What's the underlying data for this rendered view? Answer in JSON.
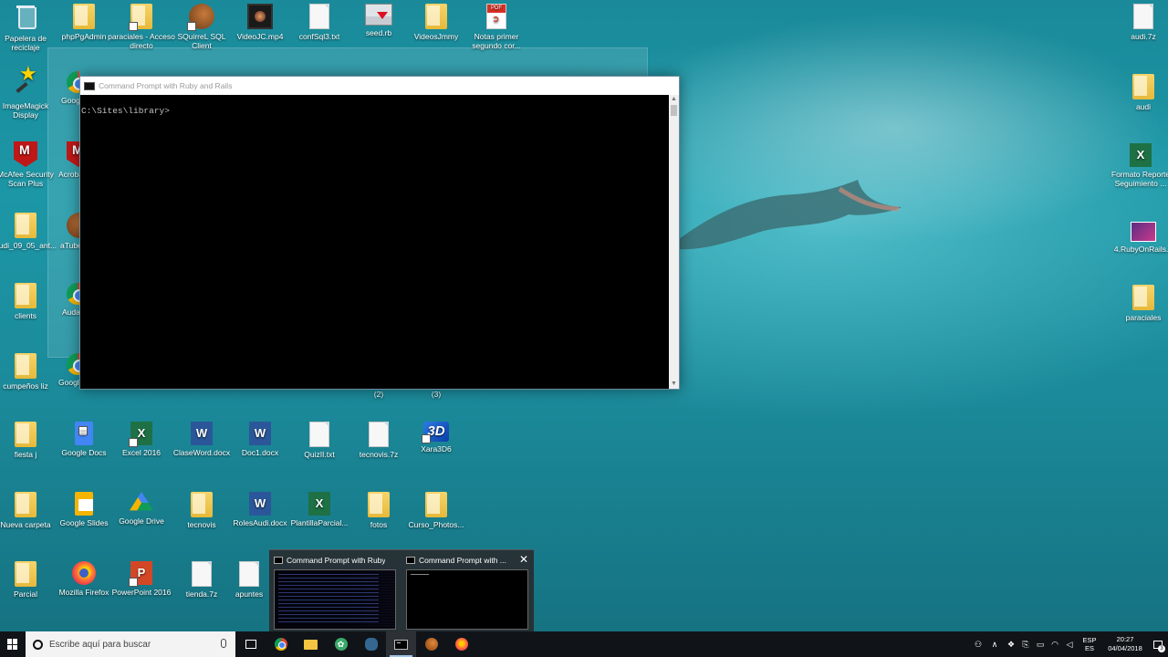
{
  "desktop": {
    "icons": [
      {
        "label": "Papelera de reciclaje",
        "icon": "recycle-bin-icon"
      },
      {
        "label": "phpPgAdmin",
        "icon": "folder-icon"
      },
      {
        "label": "paraciales - Acceso directo",
        "icon": "folder-shortcut-icon"
      },
      {
        "label": "SQuirreL SQL Client",
        "icon": "squirrel-icon"
      },
      {
        "label": "VideoJC.mp4",
        "icon": "video-icon"
      },
      {
        "label": "confSql3.txt",
        "icon": "text-file-icon"
      },
      {
        "label": "seed.rb",
        "icon": "ruby-file-icon"
      },
      {
        "label": "VideosJmmy",
        "icon": "folder-icon"
      },
      {
        "label": "Notas primer segundo cor...",
        "icon": "pdf-icon"
      },
      {
        "label": "audi.7z",
        "icon": "archive-file-icon"
      },
      {
        "label": "ImageMagick Display",
        "icon": "imagemagick-icon"
      },
      {
        "label": "Goog",
        "icon": "google-icon"
      },
      {
        "label": "audi",
        "icon": "folder-icon"
      },
      {
        "label": "McAfee Security Scan Plus",
        "icon": "mcafee-icon"
      },
      {
        "label": "Acroba",
        "icon": "acrobat-icon"
      },
      {
        "label": "Formato Reporte Seguimiento ...",
        "icon": "excel-icon"
      },
      {
        "label": "audi_09_05_ant...",
        "icon": "folder-icon"
      },
      {
        "label": "aTube",
        "icon": "atube-icon"
      },
      {
        "label": "4.RubyOnRails...",
        "icon": "certificate-icon"
      },
      {
        "label": "clients",
        "icon": "folder-icon"
      },
      {
        "label": "Auda",
        "icon": "audacity-icon"
      },
      {
        "label": "paraciales",
        "icon": "folder-icon"
      },
      {
        "label": "cumpeños liz",
        "icon": "folder-icon"
      },
      {
        "label": "Googl",
        "icon": "chrome-icon"
      },
      {
        "label": "(2)",
        "icon": "none"
      },
      {
        "label": "(3)",
        "icon": "none"
      },
      {
        "label": "fiesta j",
        "icon": "folder-icon"
      },
      {
        "label": "Google Docs",
        "icon": "google-docs-icon"
      },
      {
        "label": "Excel 2016",
        "icon": "excel-icon"
      },
      {
        "label": "ClaseWord.docx",
        "icon": "word-icon"
      },
      {
        "label": "Doc1.docx",
        "icon": "word-icon"
      },
      {
        "label": "QuizII.txt",
        "icon": "text-file-icon"
      },
      {
        "label": "tecnovis.7z",
        "icon": "archive-file-icon"
      },
      {
        "label": "Xara3D6",
        "icon": "xara3d-icon"
      },
      {
        "label": "Nueva carpeta",
        "icon": "folder-icon"
      },
      {
        "label": "Google Slides",
        "icon": "google-slides-icon"
      },
      {
        "label": "Google Drive",
        "icon": "google-drive-icon"
      },
      {
        "label": "tecnovis",
        "icon": "folder-icon"
      },
      {
        "label": "RolesAudi.docx",
        "icon": "word-icon"
      },
      {
        "label": "PlantillaParcial...",
        "icon": "excel-icon"
      },
      {
        "label": "fotos",
        "icon": "folder-icon"
      },
      {
        "label": "Curso_Photos...",
        "icon": "folder-icon"
      },
      {
        "label": "Parcial",
        "icon": "folder-icon"
      },
      {
        "label": "Mozilla Firefox",
        "icon": "firefox-icon"
      },
      {
        "label": "PowerPoint 2016",
        "icon": "powerpoint-icon"
      },
      {
        "label": "tienda.7z",
        "icon": "archive-file-icon"
      },
      {
        "label": "apuntes",
        "icon": "text-file-icon"
      }
    ]
  },
  "cmd_window": {
    "title": "Command Prompt with Ruby and Rails",
    "prompt": "C:\\Sites\\library>"
  },
  "taskbar_previews": {
    "items": [
      {
        "title": "Command Prompt with Ruby a..."
      },
      {
        "title": "Command Prompt with ..."
      }
    ],
    "close_glyph": "✕"
  },
  "taskbar": {
    "search_placeholder": "Escribe aquí para buscar",
    "tray": {
      "lang_top": "ESP",
      "lang_bottom": "ES",
      "time": "20:27",
      "date": "04/04/2018",
      "notification_count": "3"
    }
  },
  "colors": {
    "desktop_bg": "#1b8a9a",
    "taskbar_bg": "#101418",
    "console_bg": "#000000",
    "console_text": "#c0c0c0"
  }
}
